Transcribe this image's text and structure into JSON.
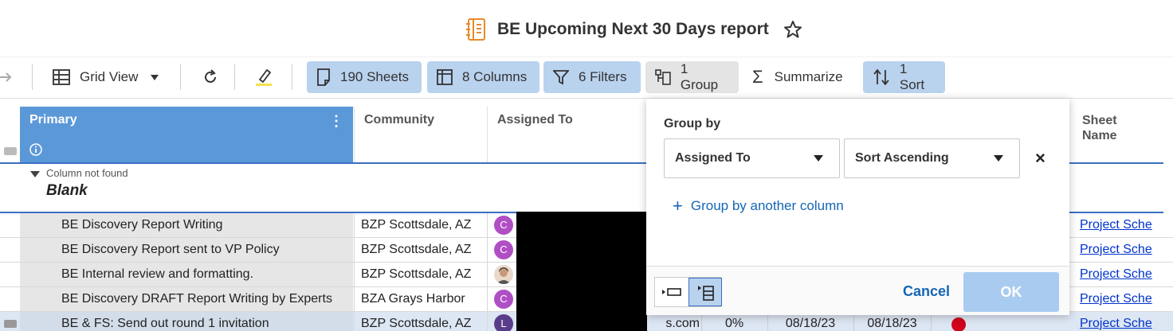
{
  "title": "BE Upcoming Next 30 Days report",
  "toolbar": {
    "grid_view": "Grid View",
    "sheets": "190 Sheets",
    "columns": "8 Columns",
    "filters": "6 Filters",
    "group": "1 Group",
    "summarize": "Summarize",
    "sort": "1 Sort"
  },
  "columns": {
    "primary": "Primary",
    "community": "Community",
    "assigned_to": "Assigned To",
    "sheet_name_1": "Sheet",
    "sheet_name_2": "Name"
  },
  "group": {
    "note": "Column not found",
    "label": "Blank"
  },
  "rows": [
    {
      "name": "BE Discovery Report Writing",
      "community": "BZP Scottsdale, AZ",
      "avatar": "C",
      "link": "Project Sche"
    },
    {
      "name": "BE Discovery Report sent to VP Policy",
      "community": "BZP Scottsdale, AZ",
      "avatar": "C",
      "link": "Project Sche"
    },
    {
      "name": "BE Internal review and formatting.",
      "community": "BZP Scottsdale, AZ",
      "avatar": "",
      "link": "Project Sche"
    },
    {
      "name": "BE Discovery DRAFT Report Writing by Experts",
      "community": "BZA Grays Harbor",
      "avatar": "C",
      "link": "Project Sche"
    },
    {
      "name": "BE & FS: Send out round 1 invitation",
      "community": "BZP Scottsdale, AZ",
      "avatar": "L",
      "email_tail": "s.com",
      "percent": "0%",
      "date1": "08/18/23",
      "date2": "08/18/23",
      "link": "Project Sche"
    }
  ],
  "popup": {
    "label": "Group by",
    "group_by_value": "Assigned To",
    "sort_value": "Sort Ascending",
    "add_column": "Group by another column",
    "cancel": "Cancel",
    "ok": "OK"
  },
  "colors": {
    "accent": "#5b98d8",
    "active_button": "#b9d2ee",
    "link": "#1566b5",
    "avatar_purple": "#b04fc4",
    "avatar_dark": "#5a3d8a",
    "status_red": "#d0021b"
  }
}
